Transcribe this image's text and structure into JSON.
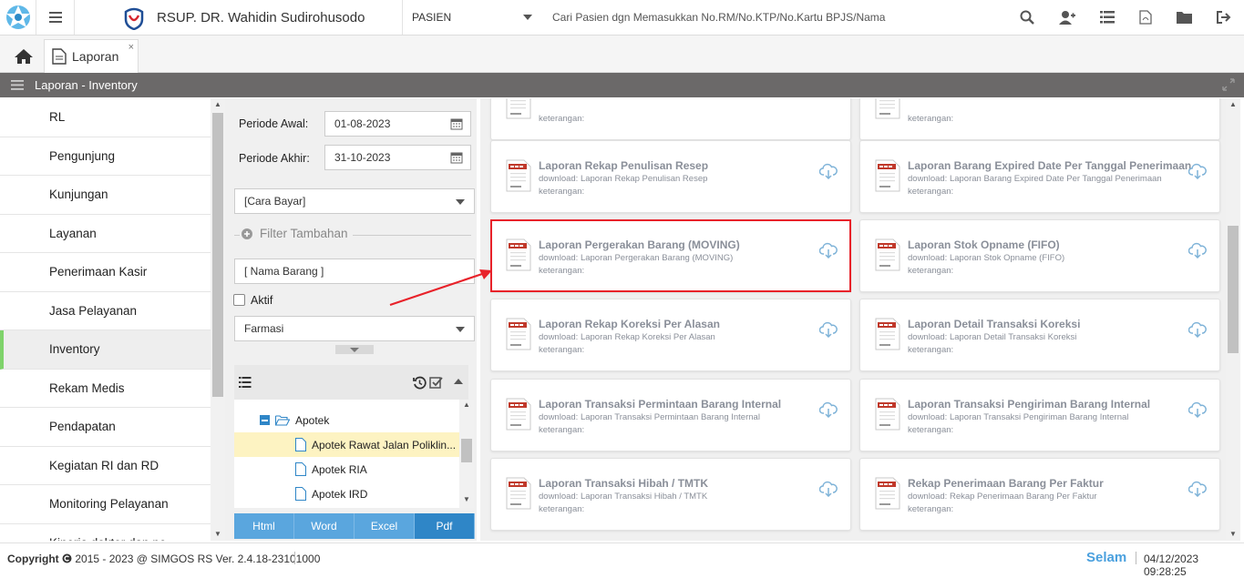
{
  "header": {
    "hospital_name": "RSUP. DR. Wahidin Sudirohusodo",
    "patient_mode": "PASIEN",
    "search_placeholder": "Cari Pasien dgn Memasukkan No.RM/No.KTP/No.Kartu BPJS/Nama"
  },
  "tabs": {
    "active_label": "Laporan",
    "close_glyph": "×"
  },
  "page_title": "Laporan - Inventory",
  "nav": {
    "items": [
      {
        "label": "RL"
      },
      {
        "label": "Pengunjung"
      },
      {
        "label": "Kunjungan"
      },
      {
        "label": "Layanan"
      },
      {
        "label": "Penerimaan Kasir"
      },
      {
        "label": "Jasa Pelayanan"
      },
      {
        "label": "Inventory"
      },
      {
        "label": "Rekam Medis"
      },
      {
        "label": "Pendapatan"
      },
      {
        "label": "Kegiatan RI dan RD"
      },
      {
        "label": "Monitoring Pelayanan"
      },
      {
        "label": "Kinerja dokter dan pe"
      }
    ],
    "active_index": 6
  },
  "filter": {
    "periode_awal_label": "Periode Awal:",
    "periode_awal_value": "01-08-2023",
    "periode_akhir_label": "Periode Akhir:",
    "periode_akhir_value": "31-10-2023",
    "cara_bayar": "[Cara Bayar]",
    "filter_tambahan": "Filter Tambahan",
    "nama_barang_placeholder": "[ Nama Barang ]",
    "aktif_label": "Aktif",
    "farmasi": "Farmasi",
    "tree": [
      {
        "label": "Apotek"
      },
      {
        "label": "Apotek Rawat Jalan Poliklin..."
      },
      {
        "label": "Apotek RIA"
      },
      {
        "label": "Apotek IRD"
      }
    ],
    "format_buttons": [
      "Html",
      "Word",
      "Excel",
      "Pdf"
    ]
  },
  "reports": {
    "ket": "keterangan:",
    "dl_prefix": "download: ",
    "cards": [
      {
        "title": "",
        "download": ""
      },
      {
        "title": "",
        "download": ""
      },
      {
        "title": "Laporan Rekap Penulisan Resep",
        "download": "Laporan Rekap Penulisan Resep"
      },
      {
        "title": "Laporan Barang Expired Date Per Tanggal Penerimaan",
        "download": "Laporan Barang Expired Date Per Tanggal Penerimaan"
      },
      {
        "title": "Laporan Pergerakan Barang (MOVING)",
        "download": "Laporan Pergerakan Barang (MOVING)"
      },
      {
        "title": "Laporan Stok Opname (FIFO)",
        "download": "Laporan Stok Opname (FIFO)"
      },
      {
        "title": "Laporan Rekap Koreksi Per Alasan",
        "download": "Laporan Rekap Koreksi Per Alasan"
      },
      {
        "title": "Laporan Detail Transaksi Koreksi",
        "download": "Laporan Detail Transaksi Koreksi"
      },
      {
        "title": "Laporan Transaksi Permintaan Barang Internal",
        "download": "Laporan Transaksi Permintaan Barang Internal"
      },
      {
        "title": "Laporan Transaksi Pengiriman Barang Internal",
        "download": "Laporan Transaksi Pengiriman Barang Internal"
      },
      {
        "title": "Laporan Transaksi Hibah / TMTK",
        "download": "Laporan Transaksi Hibah / TMTK"
      },
      {
        "title": "Rekap Penerimaan Barang Per Faktur",
        "download": "Rekap Penerimaan Barang Per Faktur"
      }
    ]
  },
  "footer": {
    "copyright_label": "Copyright",
    "copyright_text": "2015 - 2023 @ SIMGOS RS Ver. 2.4.18-23101000",
    "user": "Selam",
    "datetime": "04/12/2023 09:28:25"
  },
  "colors": {
    "title_bar": "#6b6969",
    "accent_blue": "#4aa0de",
    "active_nav": "#7fd36b",
    "highlight_red": "#e8222a"
  }
}
